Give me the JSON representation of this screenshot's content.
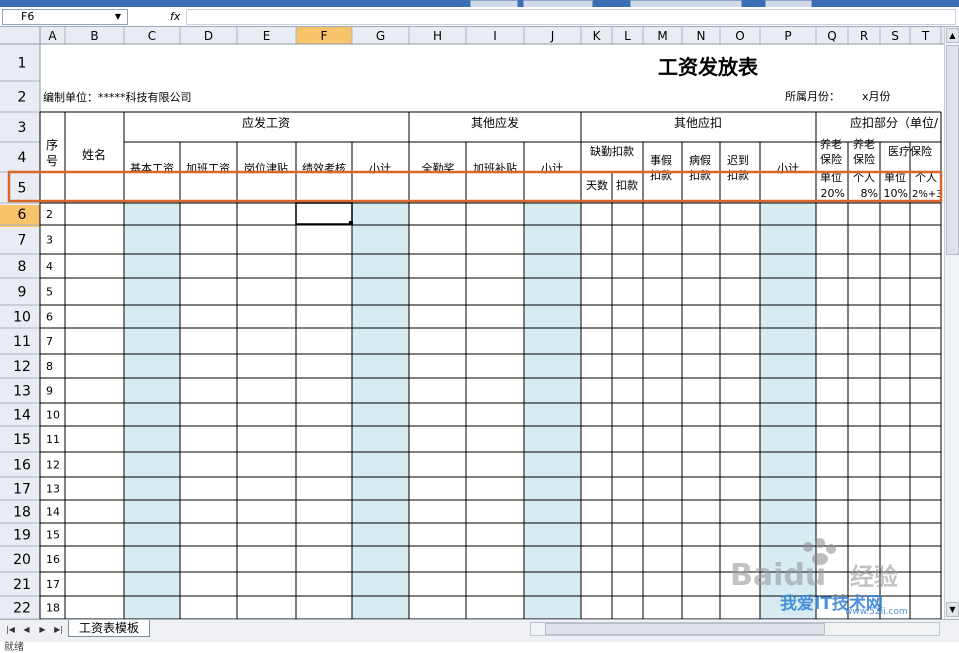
{
  "formula_bar": {
    "cell_ref": "F6",
    "fx": "fx",
    "value": ""
  },
  "columns": [
    "A",
    "B",
    "C",
    "D",
    "E",
    "F",
    "G",
    "H",
    "I",
    "J",
    "K",
    "L",
    "M",
    "N",
    "O",
    "P",
    "Q",
    "R",
    "S",
    "T"
  ],
  "rows": [
    "1",
    "2",
    "3",
    "4",
    "5",
    "6",
    "7",
    "8",
    "9",
    "10",
    "11",
    "12",
    "13",
    "14",
    "15",
    "16",
    "17",
    "18",
    "19",
    "20",
    "21",
    "22"
  ],
  "sheet": {
    "title": "工资发放表",
    "company": "编制单位：*****科技有限公司",
    "month_label": "所属月份：",
    "month_value": "x月份",
    "seq": "序号",
    "name": "姓名",
    "should_pay": "应发工资",
    "base_salary": "基本工资",
    "overtime_pay": "加班工资",
    "post_allowance": "岗位津贴",
    "performance": "绩效考核",
    "subtotal": "小计",
    "other_pay": "其他应发",
    "attendance_bonus": "全勤奖",
    "overtime_subsidy": "加班补贴",
    "other_deduct": "其他应扣",
    "absence_deduct": "缺勤扣款",
    "days": "天数",
    "deduction": "扣款",
    "personal_leave": "事假扣款",
    "sick_leave": "病假扣款",
    "late": "迟到扣款",
    "social_deduct": "应扣部分（单位/",
    "pension_unit": "养老保险",
    "pension_personal": "养老保险",
    "medical": "医疗保险",
    "unit": "单位",
    "personal": "个人",
    "rate_20": "20%",
    "rate_8": "8%",
    "rate_10": "10%",
    "rate_2": "2%+3"
  },
  "row_numbers": [
    "2",
    "3",
    "4",
    "5",
    "6",
    "7",
    "8",
    "9",
    "10",
    "11",
    "12",
    "13",
    "14",
    "15",
    "16",
    "17",
    "18"
  ],
  "tabs": {
    "sheet1": "工资表模板"
  },
  "status": "就绪",
  "watermark": {
    "brand": "Baidu",
    "jingyan": "经验",
    "site": "我爱IT技术网",
    "url": "www.52ij.com"
  }
}
